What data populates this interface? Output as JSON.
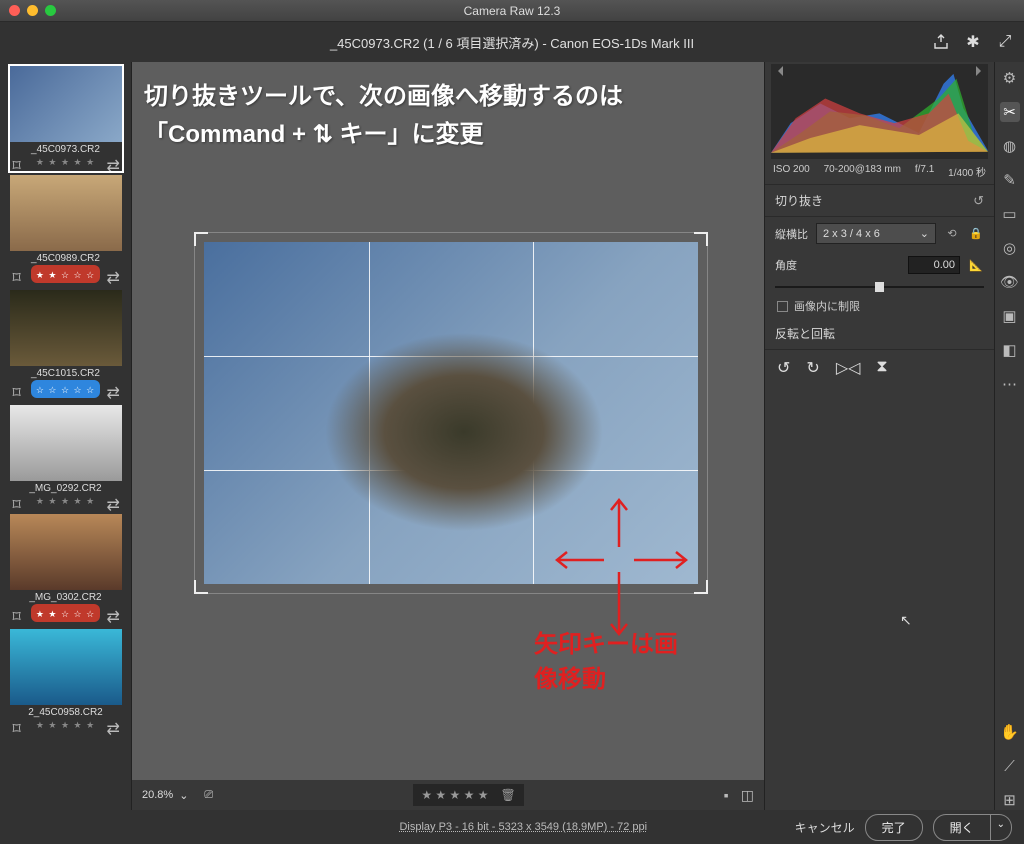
{
  "titlebar": {
    "title": "Camera Raw 12.3"
  },
  "header": {
    "file_label": "_45C0973.CR2 (1 / 6 項目選択済み)  -  Canon EOS-1Ds Mark III"
  },
  "filmstrip": [
    {
      "name": "_45C0973.CR2",
      "rating": "★ ★ ★ ★ ★",
      "selected": true,
      "badge": null
    },
    {
      "name": "_45C0989.CR2",
      "rating": "★ ★ ☆ ☆ ☆",
      "selected": false,
      "badge": "r"
    },
    {
      "name": "_45C1015.CR2",
      "rating": "☆ ☆ ☆ ☆ ☆",
      "selected": false,
      "badge": "b"
    },
    {
      "name": "_MG_0292.CR2",
      "rating": "★ ★ ★ ★ ★",
      "selected": false,
      "badge": null
    },
    {
      "name": "_MG_0302.CR2",
      "rating": "★ ★ ☆ ☆ ☆",
      "selected": false,
      "badge": "r"
    },
    {
      "name": "2_45C0958.CR2",
      "rating": "★ ★ ★ ★ ★",
      "selected": false,
      "badge": null
    }
  ],
  "overlay": {
    "line1": "切り抜きツールで、次の画像へ移動するのは",
    "line2": "「Command + ⇅ キー」に変更",
    "arrow_label": "矢印キーは画像移動"
  },
  "exif": {
    "iso": "ISO 200",
    "lens": "70-200@183 mm",
    "aperture": "f/7.1",
    "shutter": "1/400 秒"
  },
  "crop": {
    "section": "切り抜き",
    "aspect_label": "縦横比",
    "aspect_value": "2 x 3 / 4 x 6",
    "angle_label": "角度",
    "angle_value": "0.00",
    "constrain": "画像内に制限"
  },
  "transform": {
    "section": "反転と回転"
  },
  "footer": {
    "zoom": "20.8%",
    "star_bar": "★ ★ ★ ★ ★",
    "info": "Display P3 - 16 bit - 5323 x 3549 (18.9MP) - 72 ppi"
  },
  "buttons": {
    "cancel": "キャンセル",
    "done": "完了",
    "open": "開く"
  }
}
